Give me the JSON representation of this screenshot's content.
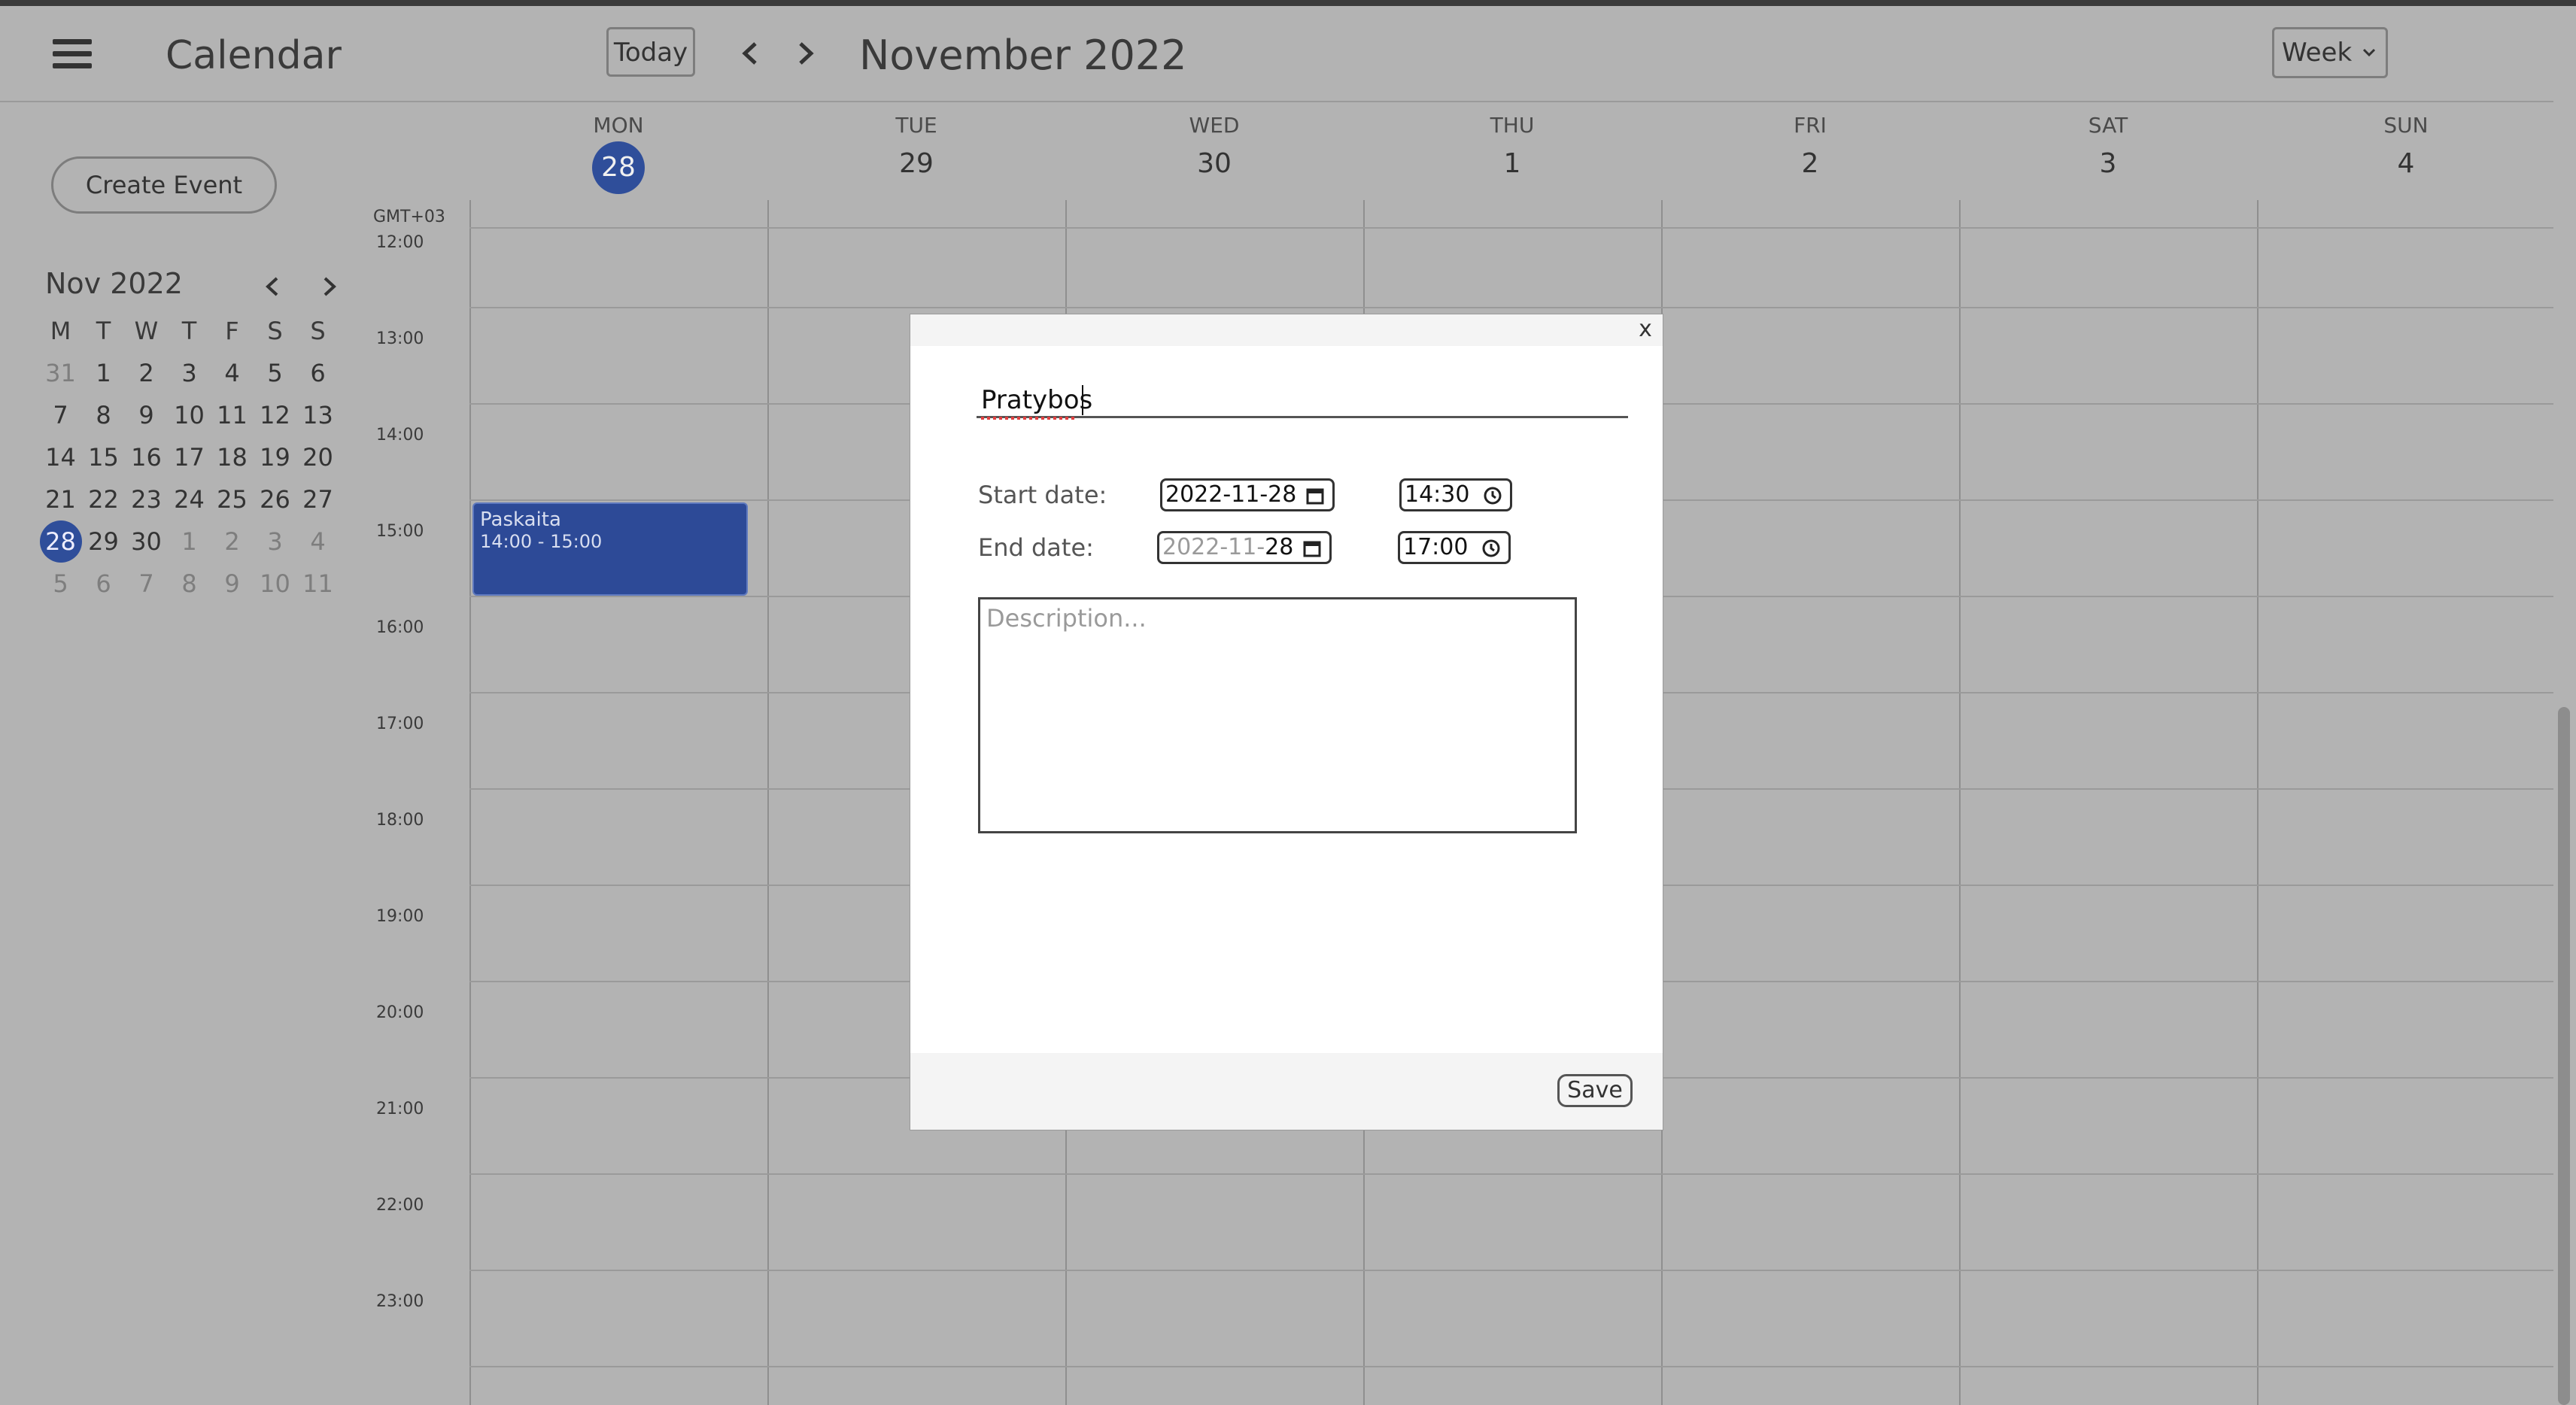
{
  "header": {
    "app_title": "Calendar",
    "today_label": "Today",
    "month_title": "November 2022",
    "view_selected": "Week"
  },
  "sidebar": {
    "create_label": "Create Event",
    "mini_month": "Nov 2022",
    "weekday_heads": [
      "M",
      "T",
      "W",
      "T",
      "F",
      "S",
      "S"
    ],
    "weeks": [
      [
        "31",
        "1",
        "2",
        "3",
        "4",
        "5",
        "6"
      ],
      [
        "7",
        "8",
        "9",
        "10",
        "11",
        "12",
        "13"
      ],
      [
        "14",
        "15",
        "16",
        "17",
        "18",
        "19",
        "20"
      ],
      [
        "21",
        "22",
        "23",
        "24",
        "25",
        "26",
        "27"
      ],
      [
        "28",
        "29",
        "30",
        "1",
        "2",
        "3",
        "4"
      ],
      [
        "5",
        "6",
        "7",
        "8",
        "9",
        "10",
        "11"
      ]
    ],
    "selected_day": "28"
  },
  "week": {
    "timezone": "GMT+03",
    "days": [
      {
        "name": "MON",
        "num": "28"
      },
      {
        "name": "TUE",
        "num": "29"
      },
      {
        "name": "WED",
        "num": "30"
      },
      {
        "name": "THU",
        "num": "1"
      },
      {
        "name": "FRI",
        "num": "2"
      },
      {
        "name": "SAT",
        "num": "3"
      },
      {
        "name": "SUN",
        "num": "4"
      }
    ],
    "hours": [
      "12:00",
      "13:00",
      "14:00",
      "15:00",
      "16:00",
      "17:00",
      "18:00",
      "19:00",
      "20:00",
      "21:00",
      "22:00",
      "23:00"
    ]
  },
  "event": {
    "title": "Paskaita",
    "time": "14:00 - 15:00",
    "color": "#2d4a97"
  },
  "modal": {
    "close": "x",
    "title_value": "Pratybos",
    "start_label": "Start date:",
    "end_label": "End date:",
    "start_date": "2022-11-28",
    "start_time": "14:30",
    "end_date_muted": "2022-11-",
    "end_date_day": "28",
    "end_time": "17:00",
    "description_placeholder": "Description...",
    "save_label": "Save"
  },
  "colors": {
    "accent": "#2f4e9a",
    "backdrop": "#b3b3b3"
  }
}
